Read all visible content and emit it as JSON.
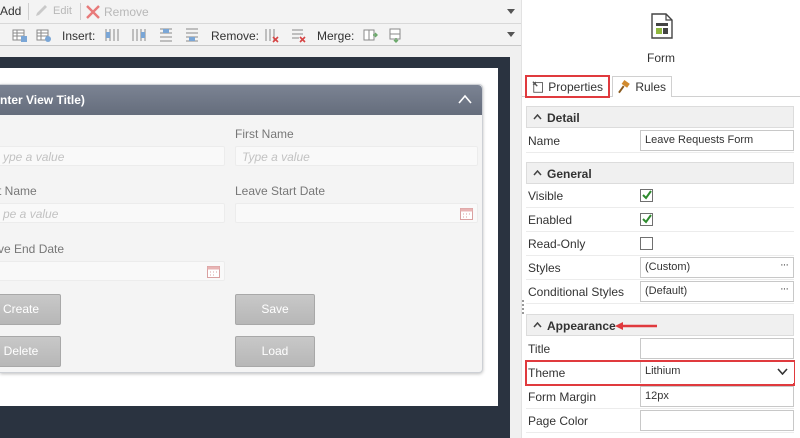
{
  "toolbar": {
    "add_label": "Add",
    "edit_label": "Edit",
    "remove_label": "Remove",
    "insert_label": "Insert:",
    "remove2_label": "Remove:",
    "merge_label": "Merge:"
  },
  "view": {
    "title": "nter View Title)",
    "fields": [
      {
        "label": "",
        "placeholder": "ype a value"
      },
      {
        "label": "First Name",
        "placeholder": "Type a value"
      },
      {
        "label": "t Name",
        "placeholder": "pe a value"
      },
      {
        "label": "Leave Start Date",
        "placeholder": ""
      },
      {
        "label": "ve End Date",
        "placeholder": ""
      }
    ],
    "buttons": {
      "create": "Create",
      "save": "Save",
      "delete": "Delete",
      "load": "Load"
    }
  },
  "panel": {
    "object_label": "Form",
    "tabs": {
      "properties": "Properties",
      "rules": "Rules"
    },
    "sections": {
      "detail": "Detail",
      "general": "General",
      "appearance": "Appearance"
    },
    "detail": {
      "name_label": "Name",
      "name_value": "Leave Requests Form"
    },
    "general": {
      "visible_label": "Visible",
      "enabled_label": "Enabled",
      "readonly_label": "Read-Only",
      "styles_label": "Styles",
      "styles_value": "(Custom)",
      "cond_styles_label": "Conditional Styles",
      "cond_styles_value": "(Default)",
      "visible": true,
      "enabled": true,
      "readonly": false
    },
    "appearance": {
      "title_label": "Title",
      "title_value": "",
      "theme_label": "Theme",
      "theme_value": "Lithium",
      "form_margin_label": "Form Margin",
      "form_margin_value": "12px",
      "page_color_label": "Page Color",
      "page_color_value": ""
    },
    "ellipsis": "···"
  },
  "colors": {
    "highlight": "#e03a3e",
    "checkmark": "#2e8b2e",
    "view_header": "#6f7787",
    "canvas_dark": "#2a3340"
  }
}
